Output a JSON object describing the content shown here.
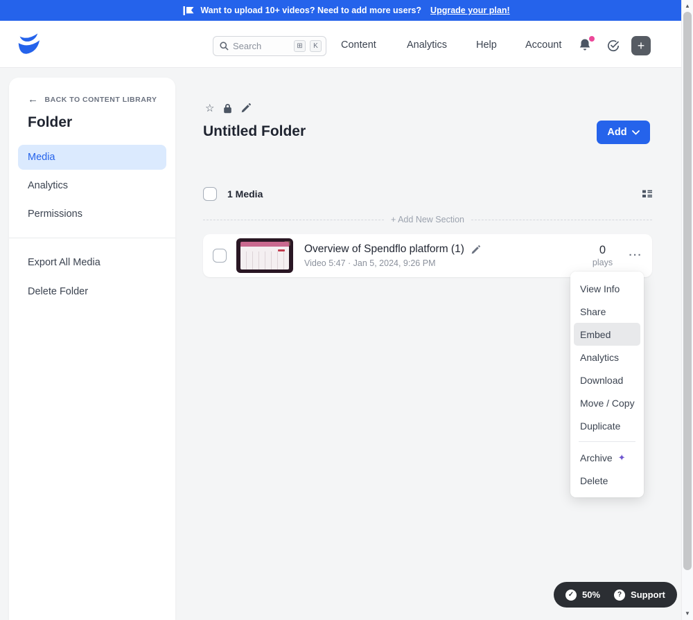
{
  "colors": {
    "banner_blue": "#2563eb",
    "accent_blue": "#2563eb",
    "active_item_bg": "#dbeafe",
    "notification_dot": "#ec4899",
    "sparkle_purple": "#6e56cf",
    "footer_pill_bg": "#2b2e33"
  },
  "banner": {
    "message": "Want to upload 10+ videos? Need to add more users?",
    "link": "Upgrade your plan!"
  },
  "header": {
    "search": {
      "placeholder": "Search",
      "keys": [
        "⊞",
        "K"
      ]
    },
    "nav": [
      {
        "label": "Content"
      },
      {
        "label": "Analytics"
      },
      {
        "label": "Help"
      },
      {
        "label": "Account"
      }
    ],
    "create_button": "+"
  },
  "sidebar": {
    "back_arrow": "←",
    "back_label": "BACK TO CONTENT LIBRARY",
    "title": "Folder",
    "nav": [
      {
        "label": "Media"
      },
      {
        "label": "Analytics"
      },
      {
        "label": "Permissions"
      }
    ],
    "actions": [
      {
        "label": "Export All Media"
      },
      {
        "label": "Delete Folder"
      }
    ]
  },
  "main": {
    "folder_icons": {
      "star": "☆"
    },
    "title": "Untitled Folder",
    "add_button": "Add",
    "media_count": "1 Media",
    "add_section_label": "+ Add New Section",
    "media_item": {
      "title": "Overview of Spendflo platform (1)",
      "meta": "Video 5:47 · Jan 5, 2024, 9:26 PM",
      "plays_value": "0",
      "plays_label": "plays",
      "menu_icon": "···"
    }
  },
  "context_menu": {
    "items": [
      "View Info",
      "Share",
      "Embed",
      "Analytics",
      "Download",
      "Move / Copy",
      "Duplicate"
    ],
    "highlighted": "Embed",
    "footer_items": [
      "Archive",
      "Delete"
    ],
    "sparkle": "✦"
  },
  "footer": {
    "check_mark": "✓",
    "progress": "50%",
    "question_mark": "?",
    "support": "Support"
  },
  "scrollbar": {
    "up": "▲",
    "down": "▼"
  }
}
